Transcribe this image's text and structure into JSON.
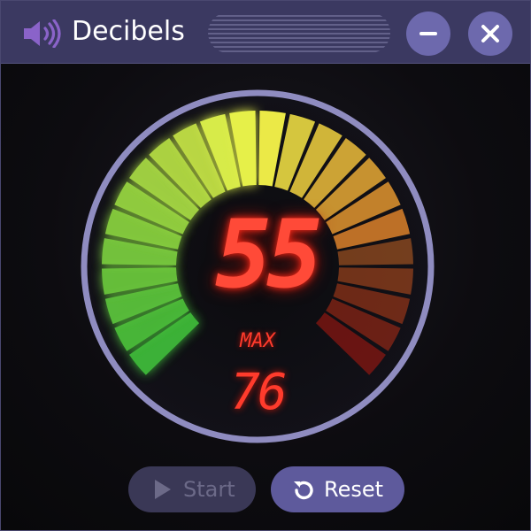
{
  "titlebar": {
    "app_icon": "speaker-icon",
    "title": "Decibels",
    "minimize_icon": "minus-icon",
    "close_icon": "close-icon"
  },
  "meter": {
    "current_value": "55",
    "max_label": "MAX",
    "max_value": "76",
    "segments": 24,
    "lit_segments": 19,
    "colors": {
      "low": "#3fbf3a",
      "mid": "#eef24a",
      "high": "#b21a10",
      "ring": "#8f8cc0",
      "digits": "#ff4a38"
    }
  },
  "controls": {
    "start_label": "Start",
    "start_icon": "play-icon",
    "start_enabled": false,
    "reset_label": "Reset",
    "reset_icon": "reset-icon"
  }
}
